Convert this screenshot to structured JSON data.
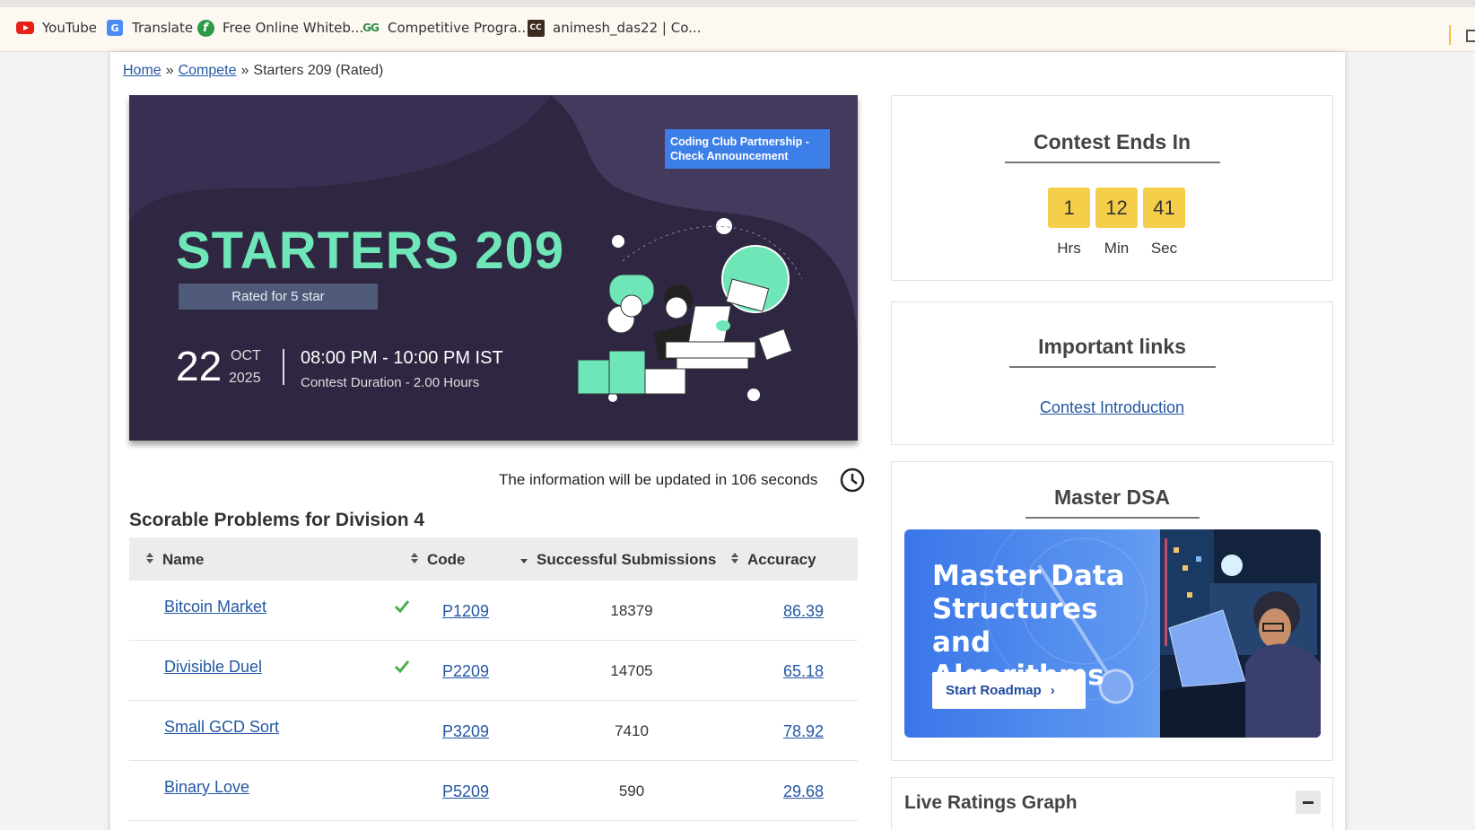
{
  "bookmarks": [
    {
      "label": "YouTube",
      "icon": "youtube-icon"
    },
    {
      "label": "Translate",
      "icon": "translate-icon"
    },
    {
      "label": "Free Online Whiteb...",
      "icon": "whiteboard-icon"
    },
    {
      "label": "Competitive Progra...",
      "icon": "geeksforgeeks-icon"
    },
    {
      "label": "animesh_das22 | Co...",
      "icon": "codechef-icon"
    }
  ],
  "breadcrumb": {
    "home": "Home",
    "sep": "»",
    "compete": "Compete",
    "current": "Starters 209 (Rated)"
  },
  "banner": {
    "tag": "Coding Club Partnership - Check Announcement",
    "title": "STARTERS 209",
    "rated": "Rated for 5 star",
    "day": "22",
    "month": "OCT",
    "year": "2025",
    "time": "08:00 PM - 10:00 PM IST",
    "duration": "Contest Duration - 2.00 Hours"
  },
  "update_notice": "The information will be updated in 106 seconds",
  "problems": {
    "title": "Scorable Problems for Division 4",
    "headers": {
      "name": "Name",
      "code": "Code",
      "submissions": "Successful Submissions",
      "accuracy": "Accuracy"
    },
    "rows": [
      {
        "name": "Bitcoin Market",
        "solved": true,
        "code": "P1209",
        "submissions": "18379",
        "accuracy": "86.39"
      },
      {
        "name": "Divisible Duel",
        "solved": true,
        "code": "P2209",
        "submissions": "14705",
        "accuracy": "65.18"
      },
      {
        "name": "Small GCD Sort",
        "solved": false,
        "code": "P3209",
        "submissions": "7410",
        "accuracy": "78.92"
      },
      {
        "name": "Binary Love",
        "solved": false,
        "code": "P5209",
        "submissions": "590",
        "accuracy": "29.68"
      }
    ]
  },
  "sidebar": {
    "countdown": {
      "title": "Contest Ends In",
      "hrs": "1",
      "min": "12",
      "sec": "41",
      "hrs_label": "Hrs",
      "min_label": "Min",
      "sec_label": "Sec"
    },
    "links": {
      "title": "Important links",
      "intro": "Contest Introduction"
    },
    "dsa": {
      "title": "Master DSA",
      "banner_text": "Master Data Structures and Algorithms",
      "button": "Start Roadmap"
    },
    "ratings": {
      "title": "Live Ratings Graph"
    }
  },
  "colors": {
    "accent_link": "#2457a4",
    "timer_box": "#f5cf4a",
    "banner_bg": "#2f2642",
    "banner_title": "#6ee6b8"
  }
}
